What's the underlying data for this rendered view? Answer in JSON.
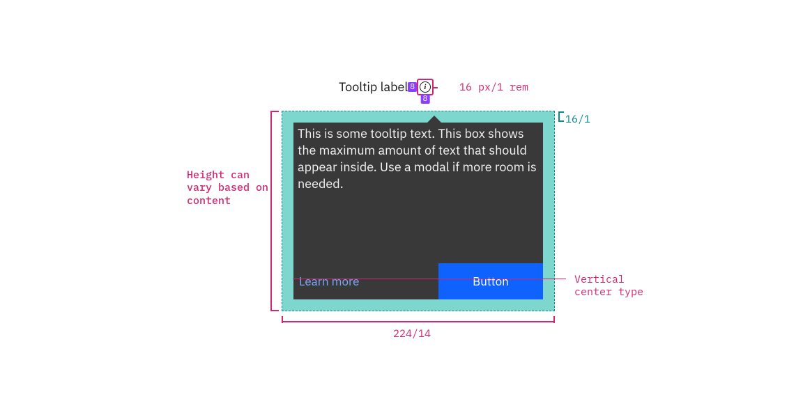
{
  "trigger": {
    "label": "Tooltip label",
    "gap_before_icon": "8",
    "gap_below_icon": "8",
    "icon_name": "information-icon"
  },
  "annotations": {
    "icon_size": "16 px/1 rem",
    "padding_top": "16/1",
    "height_note": "Height can vary based on content",
    "vertical_center": "Vertical center type",
    "width": "224/14"
  },
  "tooltip": {
    "body": "This is some tooltip text. This box shows the maximum amount of text that should appear inside. Use a modal if more room is needed.",
    "link_label": "Learn more",
    "button_label": "Button"
  }
}
